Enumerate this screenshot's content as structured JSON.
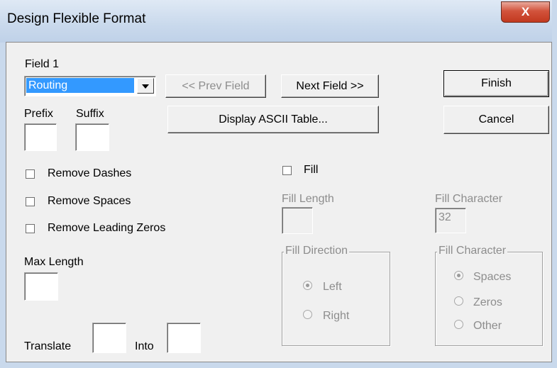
{
  "window": {
    "title": "Design Flexible Format",
    "close_label": "X"
  },
  "field_group": {
    "label": "Field 1",
    "selected_field": "Routing"
  },
  "buttons": {
    "prev_field": "<< Prev Field",
    "next_field": "Next Field >>",
    "display_ascii": "Display ASCII Table...",
    "finish": "Finish",
    "cancel": "Cancel"
  },
  "prefix": {
    "label": "Prefix",
    "value": ""
  },
  "suffix": {
    "label": "Suffix",
    "value": ""
  },
  "checkboxes": {
    "remove_dashes": "Remove Dashes",
    "remove_spaces": "Remove Spaces",
    "remove_leading_zeros": "Remove Leading Zeros",
    "fill": "Fill"
  },
  "max_length": {
    "label": "Max Length",
    "value": ""
  },
  "translate": {
    "label": "Translate",
    "into_label": "Into",
    "from_value": "",
    "into_value": ""
  },
  "fill_length": {
    "label": "Fill Length",
    "value": ""
  },
  "fill_character": {
    "label": "Fill Character",
    "value": "32"
  },
  "fill_direction": {
    "title": "Fill Direction",
    "options": [
      "Left",
      "Right"
    ],
    "selected": "Left"
  },
  "fill_character_group": {
    "title": "Fill Character",
    "options": [
      "Spaces",
      "Zeros",
      "Other"
    ],
    "selected": "Spaces"
  }
}
